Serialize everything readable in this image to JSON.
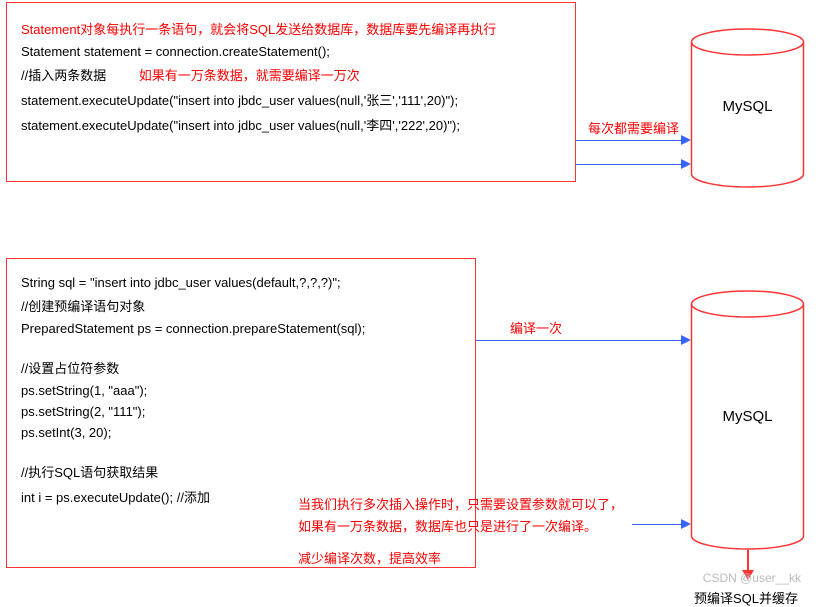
{
  "box1": {
    "title": "Statement对象每执行一条语句，就会将SQL发送给数据库，数据库要先编译再执行",
    "l1": "Statement statement = connection.createStatement();",
    "l2a": "//插入两条数据",
    "l2b": "如果有一万条数据，就需要编译一万次",
    "l3": "statement.executeUpdate(\"insert into jbdc_user values(null,'张三','111',20)\");",
    "l4": "statement.executeUpdate(\"insert into jdbc_user values(null,'李四','222',20)\");"
  },
  "note1": "每次都需要编译",
  "db_label": "MySQL",
  "box2": {
    "l1": "String sql = \"insert into jdbc_user values(default,?,?,?)\";",
    "l2": "//创建预编译语句对象",
    "l3": "PreparedStatement ps = connection.prepareStatement(sql);",
    "l4": "//设置占位符参数",
    "l5": "ps.setString(1, \"aaa\");",
    "l6": "ps.setString(2, \"111\");",
    "l7": "ps.setInt(3, 20);",
    "l8": "//执行SQL语句获取结果",
    "l9": "int i = ps.executeUpdate(); //添加"
  },
  "note2": "编译一次",
  "note3a": "当我们执行多次插入操作时，只需要设置参数就可以了，",
  "note3b": "如果有一万条数据，数据库也只是进行了一次编译。",
  "note4": "减少编译次数，提高效率",
  "bottom_text": "预编译SQL并缓存",
  "watermark": "CSDN @user__kk"
}
